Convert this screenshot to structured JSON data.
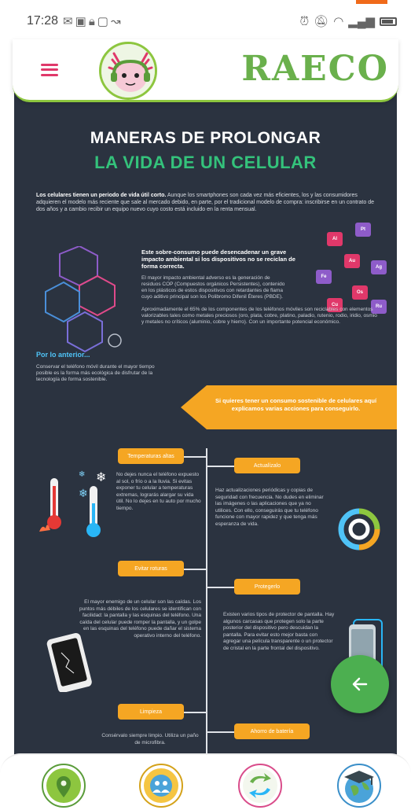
{
  "status_bar": {
    "time": "17:28",
    "left_icons": [
      "mail-icon",
      "image-icon",
      "lock-icon",
      "gallery-icon",
      "missed-call-icon"
    ],
    "right_icons": [
      "alarm-icon",
      "mute-icon",
      "wifi-icon",
      "signal-icon",
      "battery-icon"
    ]
  },
  "header": {
    "brand": "RAECO",
    "menu_icon": "hamburger-menu-icon",
    "mascot": "axolotl-mascot-avatar",
    "accent_color": "#8dc63f",
    "brand_color": "#6ab04c",
    "menu_color": "#e0386a"
  },
  "infographic": {
    "title_line1": "MANERAS DE PROLONGAR",
    "title_line2": "LA VIDA DE UN CELULAR",
    "intro_bold": "Los celulares tienen un periodo de vida útil corto.",
    "intro_rest": " Aunque los smartphones son cada vez más eficientes, los y las consumidores adquieren el modelo más reciente que sale al mercado debido, en parte, por el tradicional modelo de compra: inscribirse en un contrato de dos años y a cambio recibir un equipo nuevo cuyo costo está incluido en la renta mensual.",
    "impact_heading": "Este sobre-consumo puede desencadenar un grave impacto ambiental si los dispositivos no se reciclan de forma correcta.",
    "impact_text": "El mayor impacto ambiental adverso es la generación de residuos COP (Compuestos orgánicos Persistentes), contenido en los plásticos de estos dispositivos con retardantes de flama cuyo aditivo principal son los Polibromo Difenil Éteres (PBDE).",
    "metals_text": "Aproximadamente el 65% de los componentes de los teléfonos móviles son reciclables con elementos valorizables tales como metales preciosos (oro, plata, cobre, platino, paladio, rutenio, rodio, iridio, osmio y metales no críticos (aluminio, cobre y hierro). Con un importante potencial económico.",
    "elements": [
      "Al",
      "Pt",
      "Au",
      "Ag",
      "Fe",
      "Os",
      "Cu",
      "Ru"
    ],
    "por_heading": "Por lo anterior...",
    "por_text": "Conservar el teléfono móvil durante el mayor tiempo posible es la forma más ecológica de disfrutar de la tecnología de forma sostenible.",
    "banner_text": "Si quieres tener un consumo sostenible de celulares aquí explicamos varias acciones para conseguirlo.",
    "sections": [
      {
        "label": "Temperaturas altas",
        "text": "No dejes nunca el teléfono expuesto al sol, o frío o a la lluvia. Si evitas exponer tu celular a temperaturas extremas, lograrás alargar su vida útil. No lo dejes en tu auto por mucho tiempo."
      },
      {
        "label": "Actualízalo",
        "text": "Haz actualizaciones periódicas y copias de seguridad con frecuencia. No dudes en eliminar las imágenes o las aplicaciones que ya no utilices. Con ello, conseguirás que tu teléfono funcione con mayor rapidez y que tenga más esperanza de vida."
      },
      {
        "label": "Evitar roturas",
        "text": "El mayor enemigo de un celular son las caídas. Los puntos más débiles de los celulares se identifican con facilidad: la pantalla y las esquinas del teléfono. Una caída del celular puede romper la pantalla, y un golpe en las esquinas del teléfono puede dañar el sistema operativo interno del teléfono."
      },
      {
        "label": "Protegerlo",
        "text": "Existen varios tipos de protector de pantalla. Hay algunos carcasas que protegen solo la parte posterior del dispositivo pero descuidan la pantalla. Para evitar esto mejor basta con agregar una película transparente o un protector de cristal en la parte frontal del dispositivo."
      },
      {
        "label": "Limpieza",
        "text": "Consérvalo siempre limpio. Utiliza un paño de microfibra."
      },
      {
        "label": "Ahorro de batería",
        "text": ""
      }
    ],
    "background_color": "#2b3340",
    "tag_color": "#f5a623",
    "title_green": "#34c27b"
  },
  "fab": {
    "icon": "arrow-left-icon",
    "color": "#4caf50"
  },
  "bottom_nav": [
    {
      "icon": "location-pin-icon"
    },
    {
      "icon": "community-gear-icon"
    },
    {
      "icon": "recycle-arrows-icon"
    },
    {
      "icon": "graduation-globe-icon"
    }
  ]
}
